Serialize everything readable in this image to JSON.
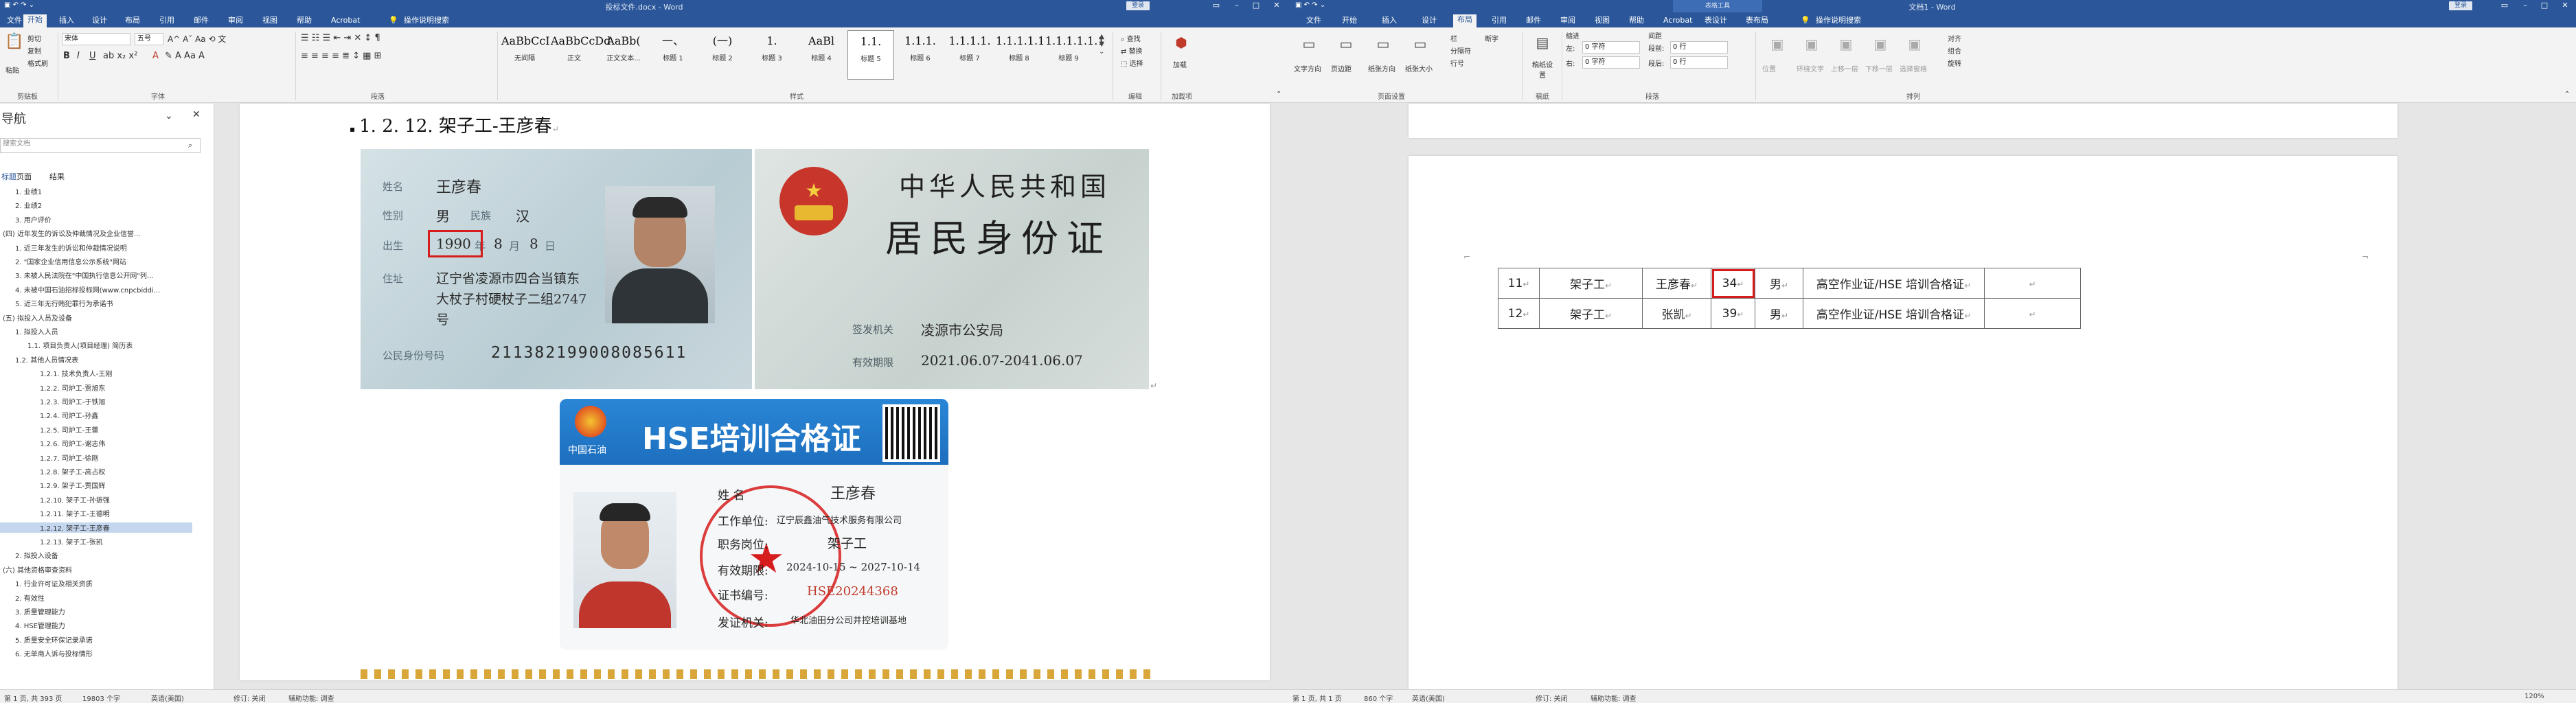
{
  "left": {
    "title": "投标文件.docx - Word",
    "account": "登录",
    "tabs": [
      "文件",
      "开始",
      "插入",
      "设计",
      "布局",
      "引用",
      "邮件",
      "审阅",
      "视图",
      "帮助",
      "Acrobat"
    ],
    "active_tab": "开始",
    "tell_me": "操作说明搜索",
    "font": {
      "name": "宋体",
      "size": "五号",
      "label": "字体"
    },
    "clipboard": {
      "paste": "粘贴",
      "cut": "剪切",
      "copy": "复制",
      "format_painter": "格式刷",
      "label": "剪贴板"
    },
    "paragraph_label": "段落",
    "styles": {
      "label": "样式",
      "items": [
        {
          "sample": "AaBbCcI",
          "name": "无间隔"
        },
        {
          "sample": "AaBbCcDd",
          "name": "正文"
        },
        {
          "sample": "AaBb(",
          "name": "正文文本..."
        },
        {
          "sample": "一、",
          "name": "标题 1"
        },
        {
          "sample": "(一)",
          "name": "标题 2"
        },
        {
          "sample": "1.",
          "name": "标题 3"
        },
        {
          "sample": "AaBl",
          "name": "标题 4"
        },
        {
          "sample": "1.1.",
          "name": "标题 5"
        },
        {
          "sample": "1.1.1.",
          "name": "标题 6"
        },
        {
          "sample": "1.1.1.1.",
          "name": "标题 7"
        },
        {
          "sample": "1.1.1.1.1",
          "name": "标题 8"
        },
        {
          "sample": "1.1.1.1.1.1",
          "name": "标题 9"
        }
      ]
    },
    "editing": {
      "find": "查找",
      "replace": "替换",
      "select": "选择",
      "label": "编辑"
    },
    "acrobat": {
      "sign": "加载",
      "label": "加载项"
    },
    "nav": {
      "title": "导航",
      "search_placeholder": "搜索文档",
      "tabs": [
        "标题",
        "页面",
        "结果"
      ],
      "items": [
        {
          "text": "1. 业绩1",
          "indent": 1
        },
        {
          "text": "2. 业绩2",
          "indent": 1
        },
        {
          "text": "3. 用户评价",
          "indent": 1
        },
        {
          "text": "(四) 近年发生的诉讼及仲裁情况及企业信誉...",
          "indent": 0
        },
        {
          "text": "1. 近三年发生的诉讼和仲裁情况说明",
          "indent": 1
        },
        {
          "text": "2. \"国家企业信用信息公示系统\"网站",
          "indent": 1
        },
        {
          "text": "3. 未被人民法院在\"中国执行信息公开网\"列...",
          "indent": 1
        },
        {
          "text": "4. 未被中国石油招标投标网(www.cnpcbiddi...",
          "indent": 1
        },
        {
          "text": "5. 近三年无行贿犯罪行为承诺书",
          "indent": 1
        },
        {
          "text": "(五) 拟投入人员及设备",
          "indent": 0
        },
        {
          "text": "1. 拟投入人员",
          "indent": 1
        },
        {
          "text": "1.1. 项目负责人(项目经理) 简历表",
          "indent": 2
        },
        {
          "text": "1.2. 其他人员情况表",
          "indent": 1
        },
        {
          "text": "1.2.1. 技术负责人-王刚",
          "indent": 3
        },
        {
          "text": "1.2.2. 司炉工-贾旭东",
          "indent": 3
        },
        {
          "text": "1.2.3. 司炉工-于铁旭",
          "indent": 3
        },
        {
          "text": "1.2.4. 司炉工-孙鑫",
          "indent": 3
        },
        {
          "text": "1.2.5. 司炉工-王蕾",
          "indent": 3
        },
        {
          "text": "1.2.6. 司炉工-谢志伟",
          "indent": 3
        },
        {
          "text": "1.2.7. 司炉工-徐刚",
          "indent": 3
        },
        {
          "text": "1.2.8. 架子工-高占权",
          "indent": 3
        },
        {
          "text": "1.2.9. 架子工-贾国辉",
          "indent": 3
        },
        {
          "text": "1.2.10. 架子工-孙振强",
          "indent": 3
        },
        {
          "text": "1.2.11. 架子工-王德明",
          "indent": 3
        },
        {
          "text": "1.2.12. 架子工-王彦春",
          "indent": 3,
          "selected": true
        },
        {
          "text": "1.2.13. 架子工-张凯",
          "indent": 3
        },
        {
          "text": "2. 拟投入设备",
          "indent": 1
        },
        {
          "text": "(六) 其他资格审查资料",
          "indent": 0
        },
        {
          "text": "1. 行业许可证及相关资质",
          "indent": 1
        },
        {
          "text": "2. 有效性",
          "indent": 1
        },
        {
          "text": "3. 质量管理能力",
          "indent": 1
        },
        {
          "text": "4. HSE管理能力",
          "indent": 1
        },
        {
          "text": "5. 质量安全环保记录承诺",
          "indent": 1
        },
        {
          "text": "6. 无单商人诉与投标情形",
          "indent": 1
        }
      ]
    },
    "document": {
      "heading": "1. 2. 12. 架子工-王彦春",
      "id_front": {
        "name_label": "姓名",
        "name": "王彦春",
        "sex_label": "性别",
        "sex": "男",
        "ethnic_label": "民族",
        "ethnic": "汉",
        "birth_label": "出生",
        "birth_year": "1990",
        "birth_mm": "年",
        "birth_month": "8",
        "birth_md": "月",
        "birth_day": "8",
        "birth_dd": "日",
        "addr_label": "住址",
        "addr_line1": "辽宁省凌源市四合当镇东",
        "addr_line2": "大杖子村硬杖子二组2747",
        "addr_line3": "号",
        "id_label": "公民身份号码",
        "id_number": "211382199008085611"
      },
      "id_back": {
        "country": "中华人民共和国",
        "card_title": "居民身份证",
        "issuer_label": "签发机关",
        "issuer": "凌源市公安局",
        "valid_label": "有效期限",
        "valid": "2021.06.07-2041.06.07"
      },
      "hse": {
        "company": "中国石油",
        "title": "HSE培训合格证",
        "name_label": "姓      名",
        "name": "王彦春",
        "unit_label": "工作单位:",
        "unit": "辽宁辰鑫油气技术服务有限公司",
        "post_label": "职务岗位:",
        "post": "架子工",
        "valid_label": "有效期限:",
        "valid": "2024-10-15 ~ 2027-10-14",
        "cert_label": "证书编号:",
        "cert": "HSE20244368",
        "issuer_label": "发证机关:",
        "issuer": "华北油田分公司井控培训基地"
      }
    },
    "status": {
      "page": "第 1 页, 共 393 页",
      "words": "19803 个字",
      "lang": "英语(美国)",
      "track": "修订: 关闭",
      "access": "辅助功能: 调查"
    }
  },
  "right": {
    "title": "文档1 - Word",
    "account": "登录",
    "context_tab_group": "表格工具",
    "tabs": [
      "文件",
      "开始",
      "插入",
      "设计",
      "布局",
      "引用",
      "邮件",
      "审阅",
      "视图",
      "帮助",
      "Acrobat",
      "表设计",
      "表布局"
    ],
    "active_tab": "布局",
    "tell_me": "操作说明搜索",
    "share": "共享",
    "page_setup": {
      "label": "页面设置",
      "items": [
        "文字方向",
        "页边距",
        "纸张方向",
        "纸张大小",
        "栏",
        "分隔符",
        "行号",
        "断字"
      ]
    },
    "draft": {
      "label": "稿纸",
      "item": "稿纸设置"
    },
    "paragraph": {
      "label": "段落",
      "indent_hdr": "缩进",
      "spacing_hdr": "间距",
      "left_label": "左:",
      "left_val": "0 字符",
      "right_label": "右:",
      "right_val": "0 字符",
      "before_label": "段前:",
      "before_val": "0 行",
      "after_label": "段后:",
      "after_val": "0 行"
    },
    "arrange": {
      "label": "排列",
      "items": [
        "位置",
        "环绕文字",
        "上移一层",
        "下移一层",
        "选择窗格",
        "对齐",
        "组合",
        "旋转"
      ]
    },
    "table": {
      "rows": [
        {
          "no": "11",
          "job": "架子工",
          "name": "王彦春",
          "age": "34",
          "sex": "男",
          "cert": "高空作业证/HSE 培训合格证",
          "extra": ""
        },
        {
          "no": "12",
          "job": "架子工",
          "name": "张凯",
          "age": "39",
          "sex": "男",
          "cert": "高空作业证/HSE 培训合格证",
          "extra": ""
        }
      ]
    },
    "status": {
      "page": "第 1 页, 共 1 页",
      "words": "860 个字",
      "lang": "英语(美国)",
      "track": "修订: 关闭",
      "access": "辅助功能: 调查",
      "zoom": "120%"
    }
  }
}
